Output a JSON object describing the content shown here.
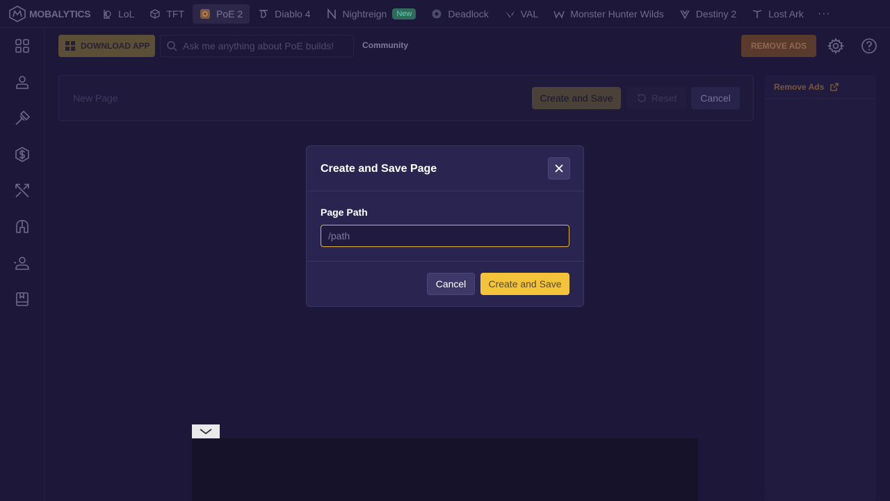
{
  "brand": {
    "logo_text": "MOBALYTICS"
  },
  "games": [
    {
      "label": "LoL",
      "icon": "lol-icon"
    },
    {
      "label": "TFT",
      "icon": "tft-icon"
    },
    {
      "label": "PoE 2",
      "icon": "poe2-icon",
      "active": true
    },
    {
      "label": "Diablo 4",
      "icon": "diablo-icon"
    },
    {
      "label": "Nightreign",
      "icon": "nightreign-icon",
      "badge": "New"
    },
    {
      "label": "Deadlock",
      "icon": "deadlock-icon"
    },
    {
      "label": "VAL",
      "icon": "valorant-icon"
    },
    {
      "label": "Monster Hunter Wilds",
      "icon": "monster-hunter-icon"
    },
    {
      "label": "Destiny 2",
      "icon": "destiny-icon"
    },
    {
      "label": "Lost Ark",
      "icon": "lost-ark-icon"
    }
  ],
  "more_label": "···",
  "header": {
    "download_label": "DOWNLOAD APP",
    "search_placeholder": "Ask me anything about PoE builds!",
    "community_label": "Community",
    "remove_ads_label": "REMOVE ADS"
  },
  "editor": {
    "page_title_placeholder": "New Page",
    "create_save_label": "Create and Save",
    "reset_label": "Reset",
    "cancel_label": "Cancel"
  },
  "ad_panel": {
    "remove_ads_label": "Remove Ads"
  },
  "modal": {
    "title": "Create and Save Page",
    "field_label": "Page Path",
    "path_placeholder": "/path",
    "cancel_label": "Cancel",
    "create_label": "Create and Save"
  },
  "colors": {
    "accent": "#f3c43a",
    "background": "#1d1839",
    "modal_bg": "#2a2550",
    "new_badge": "#2f6b5c"
  }
}
